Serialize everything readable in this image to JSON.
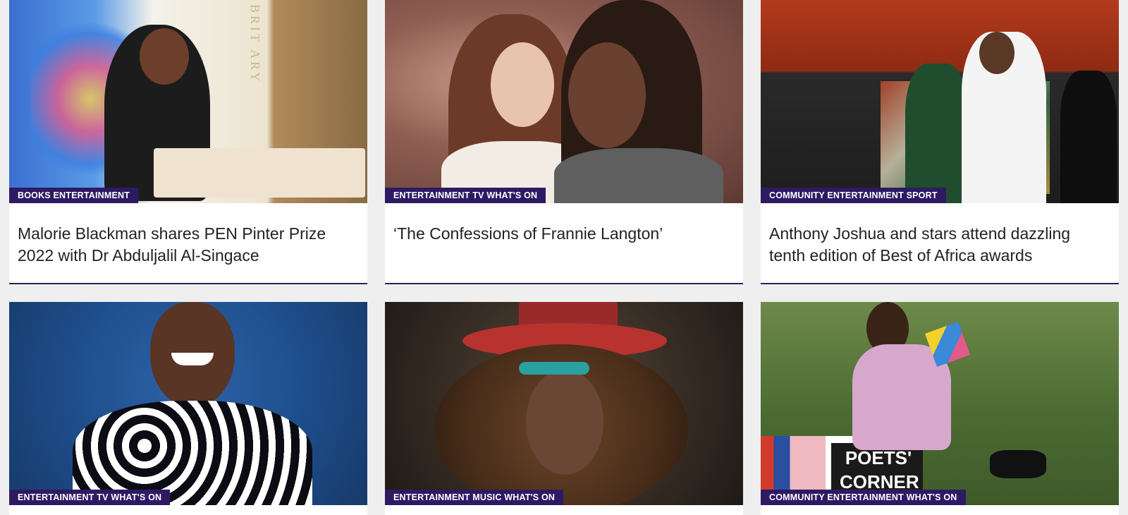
{
  "cards": [
    {
      "tags": "BOOKS ENTERTAINMENT",
      "title": "Malorie Blackman shares PEN Pinter Prize 2022 with Dr Abduljalil Al-Singace",
      "image_label": "BRIT ARY"
    },
    {
      "tags": "ENTERTAINMENT TV WHAT'S ON",
      "title": "‘The Confessions of Frannie Langton’"
    },
    {
      "tags": "COMMUNITY ENTERTAINMENT SPORT",
      "title": "Anthony Joshua and stars attend dazzling tenth edition of Best of Africa awards"
    },
    {
      "tags": "ENTERTAINMENT TV WHAT'S ON",
      "title": ""
    },
    {
      "tags": "ENTERTAINMENT MUSIC WHAT'S ON",
      "title": ""
    },
    {
      "tags": "COMMUNITY ENTERTAINMENT WHAT'S ON",
      "title": "",
      "image_label": "POETS' CORNER"
    }
  ],
  "colors": {
    "tag_bg": "#2e1a63",
    "divider": "#2b1f5e",
    "page_bg": "#efefef"
  }
}
